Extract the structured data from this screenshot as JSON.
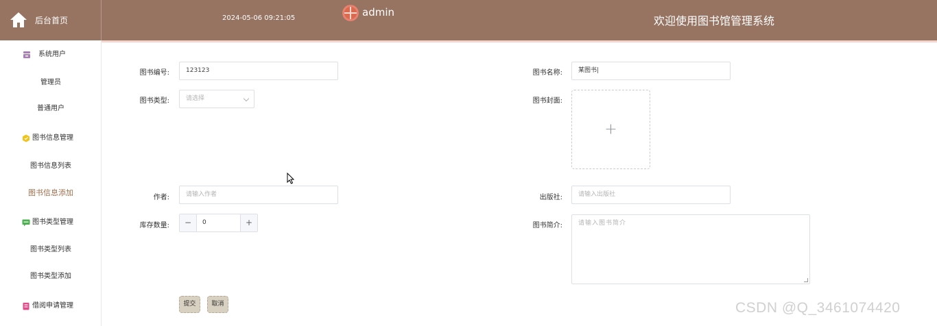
{
  "header": {
    "home_label": "后台首页",
    "datetime": "2024-05-06 09:21:05",
    "username": "admin",
    "app_title": "欢迎使用图书馆管理系统"
  },
  "sidebar": {
    "groups": [
      {
        "title": "系统用户",
        "icon": "user-group-icon",
        "items": [
          "管理员",
          "普通用户"
        ]
      },
      {
        "title": "图书信息管理",
        "icon": "book-info-icon",
        "items": [
          "图书信息列表",
          "图书信息添加"
        ]
      },
      {
        "title": "图书类型管理",
        "icon": "book-type-icon",
        "items": [
          "图书类型列表",
          "图书类型添加"
        ]
      },
      {
        "title": "借阅申请管理",
        "icon": "borrow-icon",
        "items": []
      }
    ],
    "active_item": "图书信息添加"
  },
  "form": {
    "book_no": {
      "label": "图书编号:",
      "value": "123123"
    },
    "book_name": {
      "label": "图书名称:",
      "value": "某图书|"
    },
    "book_type": {
      "label": "图书类型:",
      "placeholder": "请选择"
    },
    "cover": {
      "label": "图书封面:"
    },
    "author": {
      "label": "作者:",
      "placeholder": "请输入作者"
    },
    "publisher": {
      "label": "出版社:",
      "placeholder": "请输入出版社"
    },
    "stock": {
      "label": "库存数量:",
      "value": "0",
      "minus": "−",
      "plus": "+"
    },
    "intro": {
      "label": "图书简介:",
      "placeholder": "请输入图书简介"
    },
    "submit_label": "提交",
    "cancel_label": "取消"
  },
  "watermark": "CSDN @Q_3461074420",
  "colors": {
    "header_bg": "#977361",
    "accent": "#9c6f4e",
    "button_bg": "#d8d0c0"
  }
}
